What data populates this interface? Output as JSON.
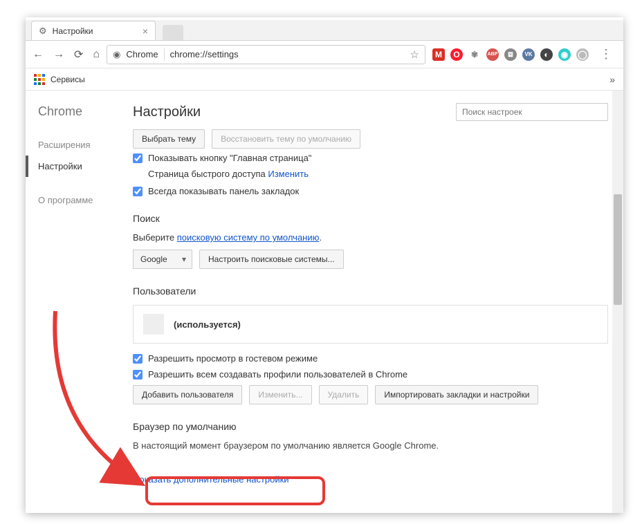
{
  "window": {
    "min": "—",
    "max": "☐",
    "close": "✕"
  },
  "tab": {
    "title": "Настройки",
    "icon": "⚙"
  },
  "nav": {
    "back": "←",
    "forward": "→",
    "reload": "⟳",
    "home": "⌂"
  },
  "omnibox": {
    "globe": "◉",
    "label": "Chrome",
    "url": "chrome://settings",
    "star": "☆"
  },
  "ext": {
    "gmail": "M",
    "opera": "O",
    "paw": "✾",
    "abp": "ABP",
    "ext1": "⧈",
    "vk": "VK",
    "ext2": "◐",
    "ext3": "◉",
    "ext4": "◯"
  },
  "menu": "⋮",
  "bookmarks": {
    "services": "Сервисы",
    "overflow": "»"
  },
  "sidebar": {
    "title": "Chrome",
    "items": [
      {
        "label": "Расширения"
      },
      {
        "label": "Настройки"
      },
      {
        "label": "О программе"
      }
    ]
  },
  "main": {
    "title": "Настройки",
    "search_placeholder": "Поиск настроек",
    "appearance": {
      "choose_theme": "Выбрать тему",
      "reset_theme": "Восстановить тему по умолчанию",
      "show_home": "Показывать кнопку \"Главная страница\"",
      "home_sub_prefix": "Страница быстрого доступа ",
      "home_sub_link": "Изменить",
      "show_bookmarks": "Всегда показывать панель закладок"
    },
    "search": {
      "title": "Поиск",
      "prefix": "Выберите ",
      "link": "поисковую систему по умолчанию",
      "suffix": ".",
      "engine": "Google",
      "manage": "Настроить поисковые системы..."
    },
    "users": {
      "title": "Пользователи",
      "current": "(используется)",
      "guest": "Разрешить просмотр в гостевом режиме",
      "allow_create": "Разрешить всем создавать профили пользователей в Chrome",
      "add": "Добавить пользователя",
      "edit": "Изменить...",
      "delete": "Удалить",
      "import": "Импортировать закладки и настройки"
    },
    "default_browser": {
      "title": "Браузер по умолчанию",
      "text": "В настоящий момент браузером по умолчанию является Google Chrome."
    },
    "advanced": "Показать дополнительные настройки"
  }
}
